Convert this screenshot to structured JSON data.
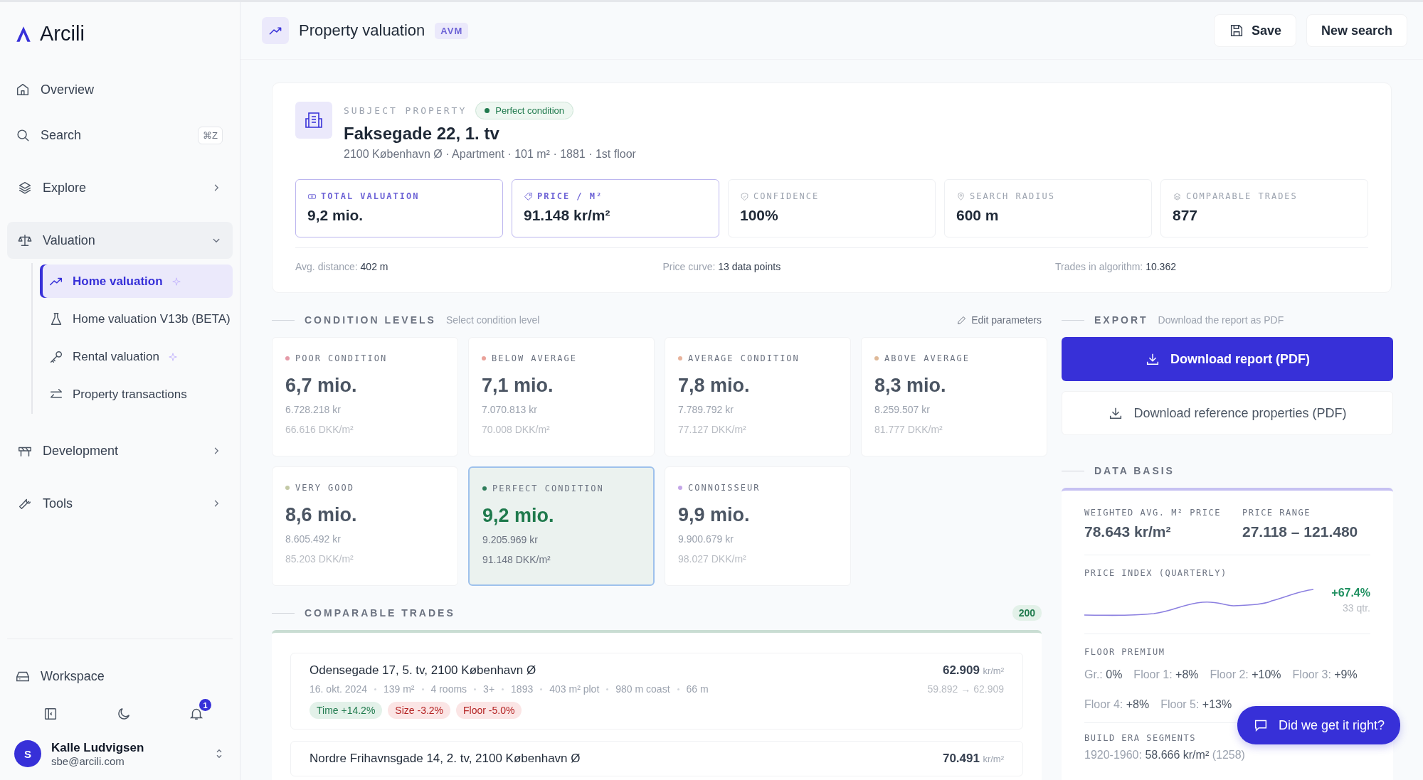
{
  "brand": {
    "name": "Arcili"
  },
  "sidebar": {
    "items": [
      {
        "label": "Overview",
        "kind": "link"
      },
      {
        "label": "Search",
        "kind": "search",
        "shortcut": "⌘Z"
      },
      {
        "label": "Explore",
        "kind": "group",
        "expanded": false
      },
      {
        "label": "Valuation",
        "kind": "group",
        "expanded": true,
        "children": [
          {
            "label": "Home valuation",
            "selected": true,
            "sparkle": true
          },
          {
            "label": "Home valuation V13b (BETA)",
            "selected": false,
            "sparkle": false
          },
          {
            "label": "Rental valuation",
            "selected": false,
            "sparkle": true
          },
          {
            "label": "Property transactions",
            "selected": false,
            "sparkle": false
          }
        ]
      },
      {
        "label": "Development",
        "kind": "group",
        "expanded": false
      },
      {
        "label": "Tools",
        "kind": "group",
        "expanded": false
      }
    ],
    "workspace": "Workspace",
    "notifications": "1",
    "user": {
      "initial": "S",
      "name": "Kalle Ludvigsen",
      "email": "sbe@arcili.com"
    }
  },
  "header": {
    "title": "Property valuation",
    "badge": "AVM",
    "buttons": [
      {
        "label": "Save"
      },
      {
        "label": "New search"
      }
    ]
  },
  "subject": {
    "eyebrow": "SUBJECT PROPERTY",
    "status": "Perfect condition",
    "address": "Faksegade 22, 1. tv",
    "details": "2100 København Ø · Apartment · 101 m² · 1881 · 1st floor",
    "stats": [
      {
        "label": "TOTAL VALUATION",
        "value": "9,2 mio.",
        "highlighted": true
      },
      {
        "label": "PRICE / M²",
        "value": "91.148 kr/m²",
        "highlighted": true
      },
      {
        "label": "CONFIDENCE",
        "value": "100%",
        "highlighted": false
      },
      {
        "label": "SEARCH RADIUS",
        "value": "600 m",
        "highlighted": false
      },
      {
        "label": "COMPARABLE TRADES",
        "value": "877",
        "highlighted": false
      }
    ],
    "footer": [
      {
        "label": "Avg. distance:",
        "value": "402 m"
      },
      {
        "label": "Price curve:",
        "value": "13 data points"
      },
      {
        "label": "Trades in algorithm:",
        "value": "10.362"
      }
    ]
  },
  "conditions": {
    "title": "CONDITION LEVELS",
    "hint": "Select condition level",
    "action": "Edit parameters",
    "levels": [
      {
        "label": "POOR CONDITION",
        "value": "6,7 mio.",
        "total": "6.728.218 kr",
        "per_m2": "66.616 DKK/m²",
        "color": "#e59aa8",
        "selected": false
      },
      {
        "label": "BELOW AVERAGE",
        "value": "7,1 mio.",
        "total": "7.070.813 kr",
        "per_m2": "70.008 DKK/m²",
        "color": "#eaa29a",
        "selected": false
      },
      {
        "label": "AVERAGE CONDITION",
        "value": "7,8 mio.",
        "total": "7.789.792 kr",
        "per_m2": "77.127 DKK/m²",
        "color": "#e8b39c",
        "selected": false
      },
      {
        "label": "ABOVE AVERAGE",
        "value": "8,3 mio.",
        "total": "8.259.507 kr",
        "per_m2": "81.777 DKK/m²",
        "color": "#dfb998",
        "selected": false
      },
      {
        "label": "VERY GOOD",
        "value": "8,6 mio.",
        "total": "8.605.492 kr",
        "per_m2": "85.203 DKK/m²",
        "color": "#c3c9a6",
        "selected": false
      },
      {
        "label": "PERFECT CONDITION",
        "value": "9,2 mio.",
        "total": "9.205.969 kr",
        "per_m2": "91.148 DKK/m²",
        "color": "#2f7d5b",
        "selected": true
      },
      {
        "label": "CONNOISSEUR",
        "value": "9,9 mio.",
        "total": "9.900.679 kr",
        "per_m2": "98.027 DKK/m²",
        "color": "#c4a6e8",
        "selected": false
      }
    ]
  },
  "comparable_trades": {
    "title": "COMPARABLE TRADES",
    "count": "200",
    "trades": [
      {
        "address": "Odensegade 17, 5. tv, 2100 København Ø",
        "meta": [
          "16. okt. 2024",
          "139 m²",
          "4 rooms",
          "3+",
          "1893",
          "403 m² plot",
          "980 m coast",
          "66 m"
        ],
        "price": "62.909",
        "unit": "kr/m²",
        "range": "59.892 → 62.909",
        "adjustments": [
          {
            "label": "Time +14.2%",
            "kind": "positive"
          },
          {
            "label": "Size -3.2%",
            "kind": "negative"
          },
          {
            "label": "Floor -5.0%",
            "kind": "negative"
          }
        ]
      },
      {
        "address": "Nordre Frihavnsgade 14, 2. tv, 2100 København Ø",
        "price": "70.491",
        "unit": "kr/m²"
      }
    ]
  },
  "export": {
    "title": "EXPORT",
    "hint": "Download the report as PDF",
    "buttons": [
      {
        "label": "Download report (PDF)",
        "kind": "primary"
      },
      {
        "label": "Download reference properties (PDF)",
        "kind": "secondary"
      }
    ]
  },
  "data_basis": {
    "title": "DATA BASIS",
    "metrics": [
      {
        "label": "WEIGHTED AVG. M² PRICE",
        "value": "78.643 kr/m²"
      },
      {
        "label": "PRICE RANGE",
        "value": "27.118 – 121.480"
      }
    ],
    "price_index": {
      "label": "PRICE INDEX (QUARTERLY)",
      "change": "+67.4%",
      "period": "33 qtr."
    },
    "floor_premium": {
      "label": "FLOOR PREMIUM",
      "items": [
        {
          "label": "Gr.:",
          "value": "0%"
        },
        {
          "label": "Floor 1:",
          "value": "+8%"
        },
        {
          "label": "Floor 2:",
          "value": "+10%"
        },
        {
          "label": "Floor 3:",
          "value": "+9%"
        },
        {
          "label": "Floor 4:",
          "value": "+8%"
        },
        {
          "label": "Floor 5:",
          "value": "+13%"
        }
      ]
    },
    "build_era": {
      "label": "BUILD ERA SEGMENTS",
      "items": [
        {
          "label": "1920-1960:",
          "value": "58.666 kr/m²",
          "count": "(1258)"
        }
      ]
    }
  },
  "feedback": {
    "label": "Did we get it right?"
  }
}
